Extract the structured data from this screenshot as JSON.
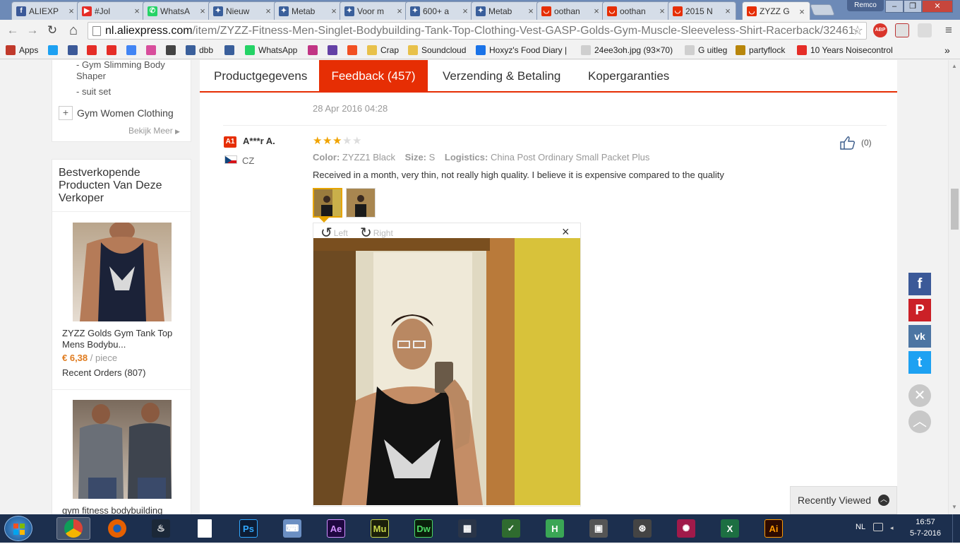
{
  "browser": {
    "tabs": [
      {
        "title": "ALIEXP",
        "icon": "facebook-icon",
        "color": "#3b5998",
        "glyph": "f"
      },
      {
        "title": "#Jol",
        "icon": "youtube-icon",
        "color": "#e52d27",
        "glyph": "▶"
      },
      {
        "title": "WhatsA",
        "icon": "whatsapp-icon",
        "color": "#25d366",
        "glyph": "✆"
      },
      {
        "title": "Nieuw",
        "icon": "ds-icon",
        "color": "#3a5f9b",
        "glyph": "✦"
      },
      {
        "title": "Metab",
        "icon": "ds-icon",
        "color": "#3a5f9b",
        "glyph": "✦"
      },
      {
        "title": "Voor m",
        "icon": "ds-icon",
        "color": "#3a5f9b",
        "glyph": "✦"
      },
      {
        "title": "600+ a",
        "icon": "ds-icon",
        "color": "#3a5f9b",
        "glyph": "✦"
      },
      {
        "title": "Metab",
        "icon": "ds-icon",
        "color": "#3a5f9b",
        "glyph": "✦"
      },
      {
        "title": "oothan",
        "icon": "aliexpress-icon",
        "color": "#e62e04",
        "glyph": "◡"
      },
      {
        "title": "oothan",
        "icon": "aliexpress-icon",
        "color": "#e62e04",
        "glyph": "◡"
      },
      {
        "title": "2015 N",
        "icon": "aliexpress-icon",
        "color": "#e62e04",
        "glyph": "◡"
      },
      {
        "title": "ZYZZ G",
        "icon": "aliexpress-icon",
        "color": "#e62e04",
        "glyph": "◡",
        "active": true
      }
    ],
    "tab_close": "×",
    "profile_name": "Remco",
    "window_buttons": {
      "minimize": "–",
      "maximize": "❐",
      "close": "✕"
    },
    "url_host": "nl.aliexpress.com",
    "url_path": "/item/ZYZZ-Fitness-Men-Singlet-Bodybuilding-Tank-Top-Clothing-Vest-GASP-Golds-Gym-Muscle-Sleeveless-Shirt-Racerback/32461-",
    "nav": {
      "back": "←",
      "forward": "→",
      "reload": "↻",
      "home": "⌂",
      "star": "☆",
      "menu": "≡",
      "more": "»"
    },
    "abp_label": "ABP",
    "bookmarks": [
      {
        "label": "Apps",
        "icon": "apps-icon",
        "color": "#c0392b"
      },
      {
        "label": "",
        "icon": "twitter-icon",
        "color": "#1da1f2"
      },
      {
        "label": "",
        "icon": "facebook-icon",
        "color": "#3b5998"
      },
      {
        "label": "",
        "icon": "youtube-icon",
        "color": "#e52d27"
      },
      {
        "label": "",
        "icon": "d-icon",
        "color": "#e52d27"
      },
      {
        "label": "",
        "icon": "google-icon",
        "color": "#4285f4"
      },
      {
        "label": "",
        "icon": "w-icon",
        "color": "#d84e9c"
      },
      {
        "label": "",
        "icon": "bitcoin-icon",
        "color": "#444444"
      },
      {
        "label": "dbb",
        "icon": "ds-icon",
        "color": "#3a5f9b"
      },
      {
        "label": "",
        "icon": "ds-icon",
        "color": "#3a5f9b"
      },
      {
        "label": "WhatsApp",
        "icon": "whatsapp-icon",
        "color": "#25d366"
      },
      {
        "label": "",
        "icon": "instagram-icon",
        "color": "#c13584"
      },
      {
        "label": "",
        "icon": "twitch-icon",
        "color": "#6441a5"
      },
      {
        "label": "",
        "icon": "windows-icon",
        "color": "#f25022"
      },
      {
        "label": "Crap",
        "icon": "folder-icon",
        "color": "#e8c14a"
      },
      {
        "label": "Soundcloud",
        "icon": "folder-icon",
        "color": "#e8c14a"
      },
      {
        "label": "Hoxyz's Food Diary | ",
        "icon": "x-icon",
        "color": "#1a73e8"
      },
      {
        "label": "24ee3oh.jpg (93×70)",
        "icon": "page-icon",
        "color": "#cfcfcf"
      },
      {
        "label": "G uitleg",
        "icon": "page-icon",
        "color": "#cfcfcf"
      },
      {
        "label": "partyflock",
        "icon": "partyflock-icon",
        "color": "#b8860b"
      },
      {
        "label": "10 Years Noisecontrol",
        "icon": "youtube-icon",
        "color": "#e52d27"
      }
    ]
  },
  "sidebar": {
    "categories": [
      "- Gym Slimming Body Shaper",
      "- suit set"
    ],
    "expand_symbol": "+",
    "women_category": "Gym Women Clothing",
    "view_more": "Bekijk Meer",
    "bestsellers_title": "Bestverkopende Producten Van Deze Verkoper",
    "products": [
      {
        "title": "ZYZZ Golds Gym Tank Top Mens Bodybu...",
        "price": "€ 6,38",
        "price_unit": "/ piece",
        "orders": "Recent Orders (807)"
      },
      {
        "title": "gym fitness bodybuilding"
      }
    ]
  },
  "product_tabs": [
    {
      "label": "Productgegevens"
    },
    {
      "label": "Feedback (457)",
      "active": true
    },
    {
      "label": "Verzending & Betaling"
    },
    {
      "label": "Kopergaranties"
    }
  ],
  "prev_review_date": "28 Apr 2016 04:28",
  "review": {
    "badge": "A1",
    "buyer": "A***r A.",
    "country": "CZ",
    "rating": 3,
    "max_rating": 5,
    "color_label": "Color:",
    "color_value": "ZYZZ1 Black",
    "size_label": "Size:",
    "size_value": "S",
    "logistics_label": "Logistics:",
    "logistics_value": "China Post Ordinary Small Packet Plus",
    "text": "Received in a month, very thin, not really high quality. I believe it is expensive compared to the quality",
    "helpful_count": "(0)",
    "viewer": {
      "rotate_left": "Left",
      "rotate_right": "Right",
      "close": "×"
    }
  },
  "recently_viewed": "Recently Viewed",
  "share": [
    {
      "glyph": "f",
      "color": "#3b5998"
    },
    {
      "glyph": "P",
      "color": "#cb2027"
    },
    {
      "glyph": "vk",
      "color": "#4c75a3"
    },
    {
      "glyph": "t",
      "color": "#1da1f2"
    }
  ],
  "taskbar": {
    "apps": [
      {
        "icon": "chrome-icon",
        "color": "#dd4b39",
        "glyph": "",
        "active": true
      },
      {
        "icon": "firefox-icon",
        "color": "#e66000",
        "glyph": ""
      },
      {
        "icon": "steam-icon",
        "color": "#1b2838",
        "glyph": "♨"
      },
      {
        "icon": "file-icon",
        "color": "#ffffff",
        "glyph": ""
      },
      {
        "icon": "photoshop-icon",
        "color": "#0d1c34",
        "glyph": "Ps",
        "fg": "#31a8ff"
      },
      {
        "icon": "keyboard-icon",
        "color": "#6b8fc3",
        "glyph": "⌨"
      },
      {
        "icon": "after-effects-icon",
        "color": "#1f0740",
        "glyph": "Ae",
        "fg": "#d291ff"
      },
      {
        "icon": "muse-icon",
        "color": "#1b1f0a",
        "glyph": "Mu",
        "fg": "#c8d84a"
      },
      {
        "icon": "dreamweaver-icon",
        "color": "#0a1f0a",
        "glyph": "Dw",
        "fg": "#4bd864"
      },
      {
        "icon": "video-icon",
        "color": "#2a3548",
        "glyph": "▦"
      },
      {
        "icon": "excel-activity-icon",
        "color": "#2f6b2f",
        "glyph": "✓"
      },
      {
        "icon": "h-icon",
        "color": "#3aa655",
        "glyph": "H"
      },
      {
        "icon": "gaming-icon",
        "color": "#555555",
        "glyph": "▣"
      },
      {
        "icon": "sync-icon",
        "color": "#444444",
        "glyph": "⊛"
      },
      {
        "icon": "bug-icon",
        "color": "#a01a4a",
        "glyph": "✺"
      },
      {
        "icon": "excel-icon",
        "color": "#1d6f42",
        "glyph": "X"
      },
      {
        "icon": "illustrator-icon",
        "color": "#2d0a00",
        "glyph": "Ai",
        "fg": "#ff9a00"
      }
    ],
    "lang": "NL",
    "time": "16:57",
    "date": "5-7-2016"
  }
}
